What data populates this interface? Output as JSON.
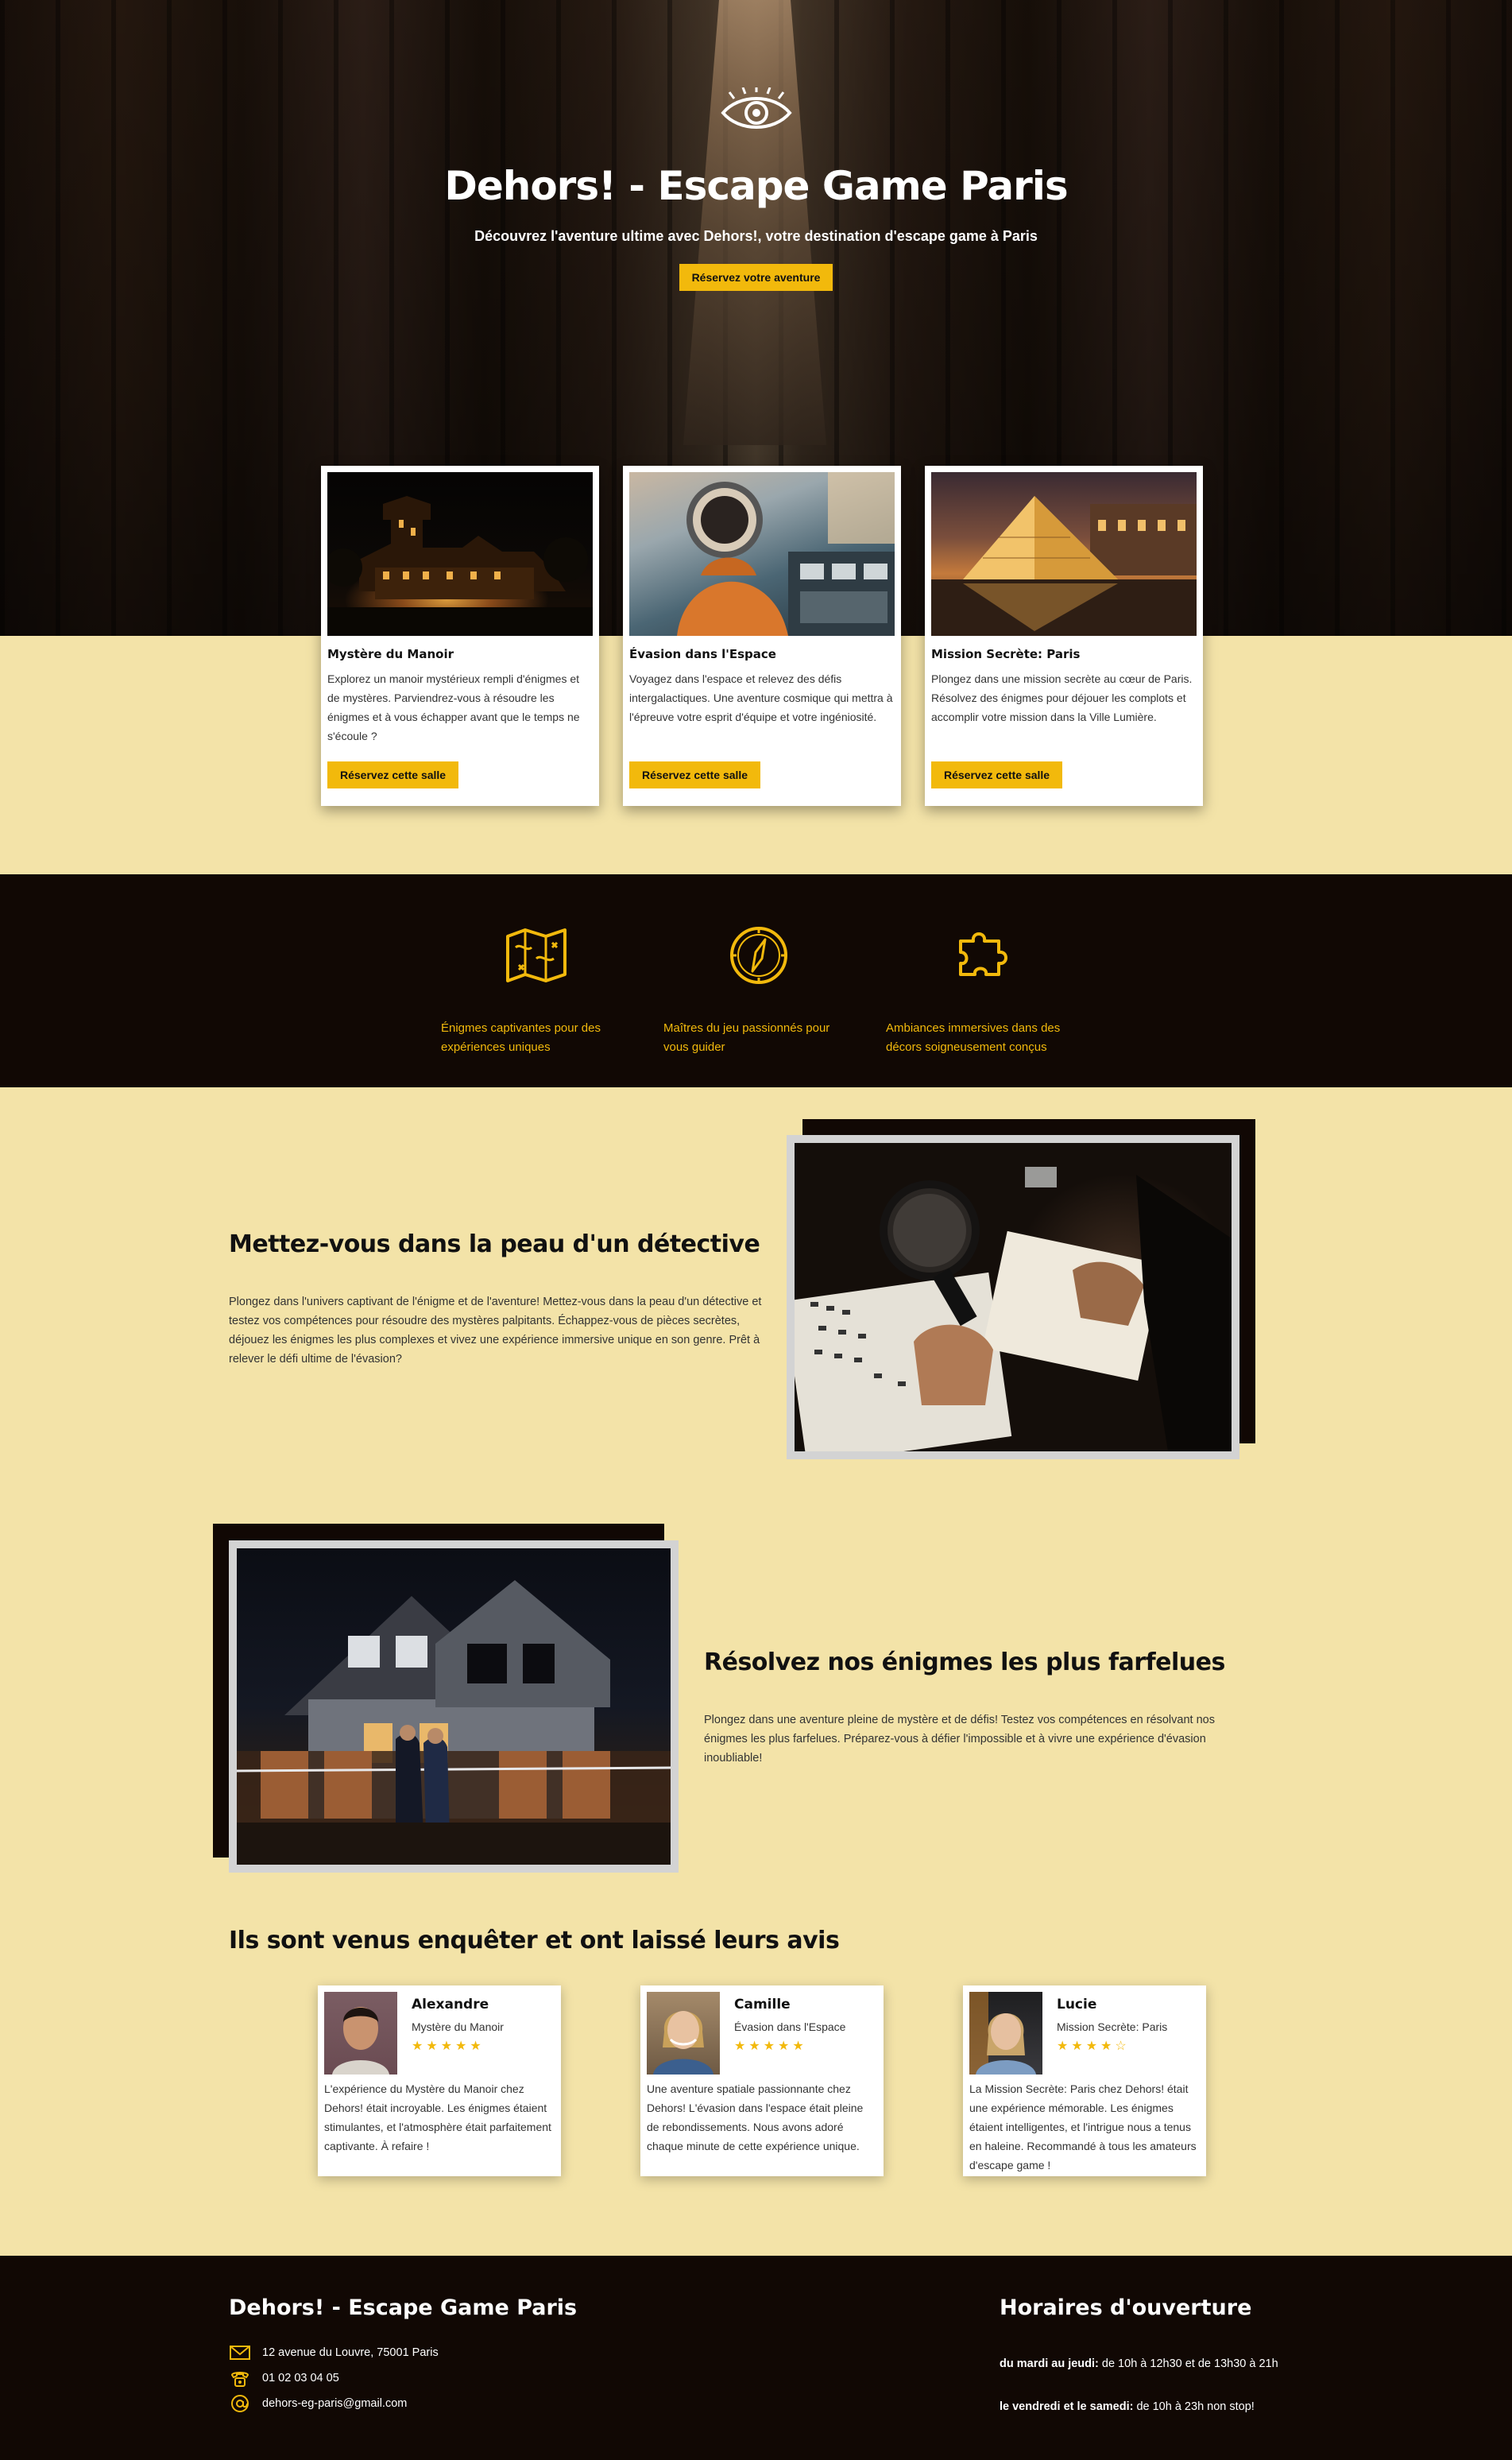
{
  "hero": {
    "title": "Dehors! - Escape Game Paris",
    "subtitle": "Découvrez l'aventure ultime avec Dehors!, votre destination d'escape game à Paris",
    "cta": "Réservez votre aventure",
    "icon": "eye-icon"
  },
  "rooms": [
    {
      "title": "Mystère du Manoir",
      "description": "Explorez un manoir mystérieux rempli d'énigmes et de mystères. Parviendrez-vous à résoudre les énigmes et à vous échapper avant que le temps ne s'écoule ?",
      "button": "Réservez cette salle"
    },
    {
      "title": "Évasion dans l'Espace",
      "description": "Voyagez dans l'espace et relevez des défis intergalactiques. Une aventure cosmique qui mettra à l'épreuve votre esprit d'équipe et votre ingéniosité.",
      "button": "Réservez cette salle"
    },
    {
      "title": "Mission Secrète: Paris",
      "description": "Plongez dans une mission secrète au cœur de Paris. Résolvez des énigmes pour déjouer les complots et accomplir votre mission dans la Ville Lumière.",
      "button": "Réservez cette salle"
    }
  ],
  "features": [
    {
      "icon": "map-icon",
      "text": "Énigmes captivantes pour des expériences uniques"
    },
    {
      "icon": "compass-icon",
      "text": "Maîtres du jeu passionnés pour vous guider"
    },
    {
      "icon": "puzzle-icon",
      "text": "Ambiances immersives dans des décors soigneusement conçus"
    }
  ],
  "detective": {
    "title": "Mettez-vous dans la peau d'un détective",
    "text": "Plongez dans l'univers captivant de l'énigme et de l'aventure! Mettez-vous dans la peau d'un détective et testez vos compétences pour résoudre des mystères palpitants. Échappez-vous de pièces secrètes, déjouez les énigmes les plus complexes et vivez une expérience immersive unique en son genre. Prêt à relever le défi ultime de l'évasion?"
  },
  "puzzles": {
    "title": "Résolvez nos énigmes les plus farfelues",
    "text": "Plongez dans une aventure pleine de mystère et de défis! Testez vos compétences en résolvant nos énigmes les plus farfelues. Préparez-vous à défier l'impossible et à vivre une expérience d'évasion inoubliable!"
  },
  "reviews": {
    "title": "Ils sont venus enquêter et ont laissé leurs avis",
    "items": [
      {
        "name": "Alexandre",
        "room": "Mystère du Manoir",
        "stars": "★★★★★",
        "rating": 5,
        "text": "L'expérience du Mystère du Manoir chez Dehors! était incroyable. Les énigmes étaient stimulantes, et l'atmosphère était parfaitement captivante. À refaire !"
      },
      {
        "name": "Camille",
        "room": "Évasion dans l'Espace",
        "stars": "★★★★★",
        "rating": 5,
        "text": "Une aventure spatiale passionnante chez Dehors! L'évasion dans l'espace était pleine de rebondissements. Nous avons adoré chaque minute de cette expérience unique."
      },
      {
        "name": "Lucie",
        "room": "Mission Secrète: Paris",
        "stars": "★★★★☆",
        "rating": 4,
        "text": "La Mission Secrète: Paris chez Dehors! était une expérience mémorable. Les énigmes étaient intelligentes, et l'intrigue nous a tenus en haleine. Recommandé à tous les amateurs d'escape game !"
      }
    ]
  },
  "footer": {
    "title": "Dehors! - Escape Game Paris",
    "address": "12 avenue du Louvre, 75001 Paris",
    "phone": "01 02 03 04 05",
    "email": "dehors-eg-paris@gmail.com",
    "hours_title": "Horaires d'ouverture",
    "hours": [
      {
        "days": "du mardi au jeudi:",
        "time": " de 10h à 12h30 et de 13h30 à 21h"
      },
      {
        "days": "le vendredi et le samedi:",
        "time": " de 10h à 23h non stop!"
      }
    ]
  },
  "colors": {
    "accent": "#f2b90c",
    "dark": "#110804",
    "cream": "#f3e3a8"
  }
}
